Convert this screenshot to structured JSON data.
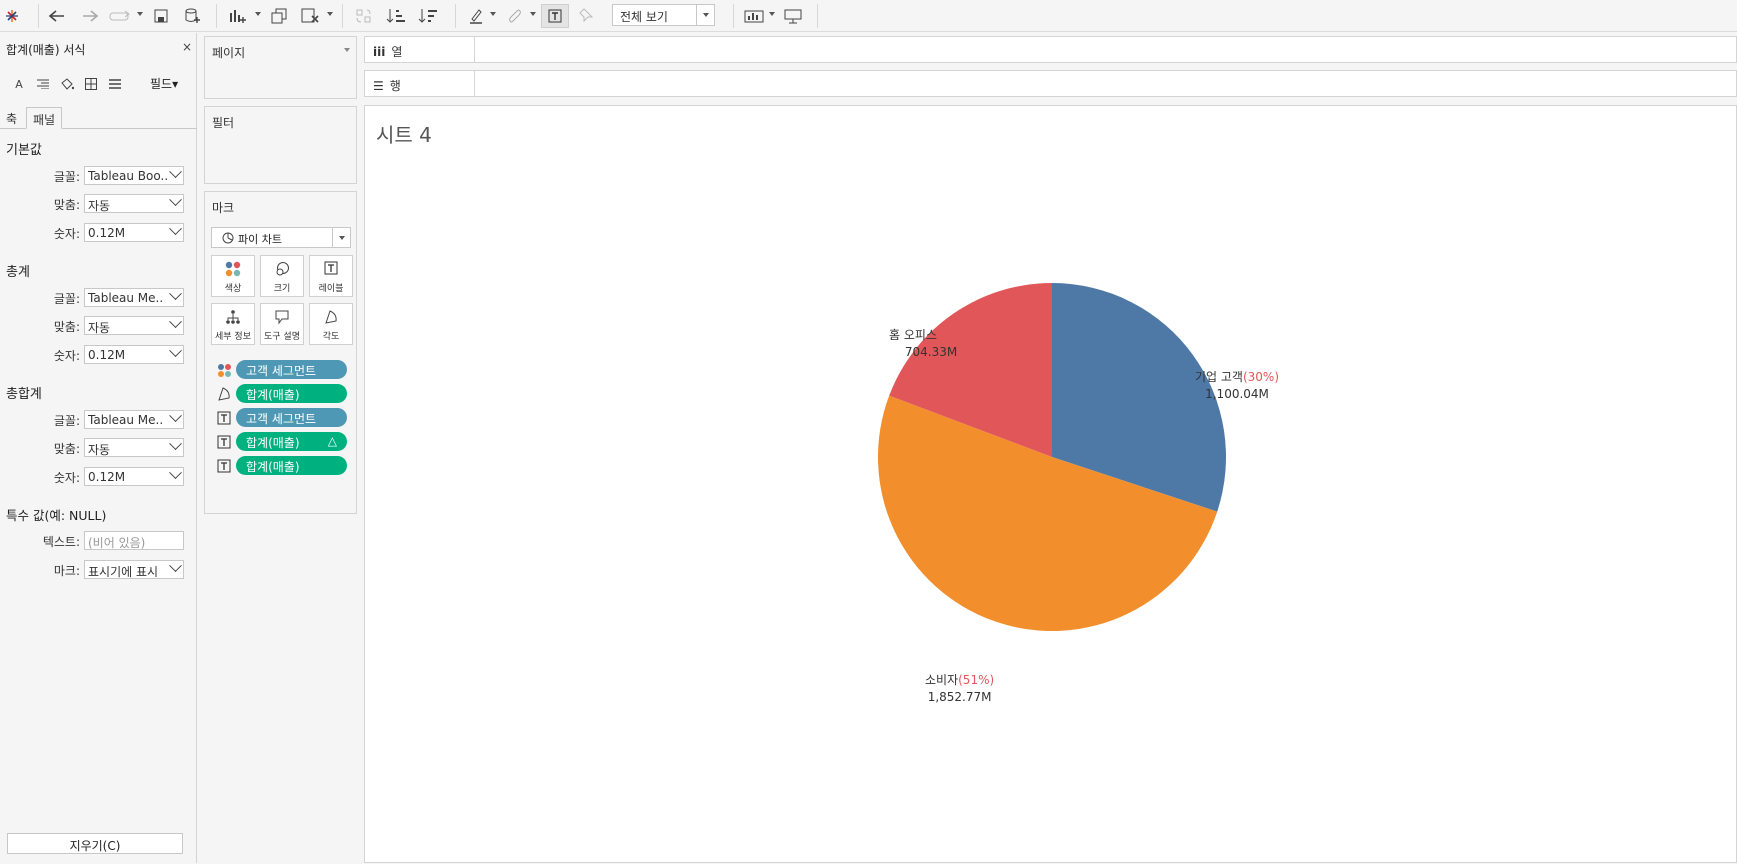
{
  "toolbar": {
    "view_select": "전체 보기"
  },
  "format_pane": {
    "title": "합계(매출) 서식",
    "close": "×",
    "field_dropdown": "필드▾",
    "tabs": [
      "축",
      "패널"
    ],
    "sections": [
      {
        "heading": "기본값",
        "rows": [
          {
            "label": "글꼴:",
            "value": "Tableau Boo.."
          },
          {
            "label": "맞춤:",
            "value": "자동"
          },
          {
            "label": "숫자:",
            "value": "0.12M"
          }
        ]
      },
      {
        "heading": "총계",
        "rows": [
          {
            "label": "글꼴:",
            "value": "Tableau Me.."
          },
          {
            "label": "맞춤:",
            "value": "자동"
          },
          {
            "label": "숫자:",
            "value": "0.12M"
          }
        ]
      },
      {
        "heading": "총합계",
        "rows": [
          {
            "label": "글꼴:",
            "value": "Tableau Me.."
          },
          {
            "label": "맞춤:",
            "value": "자동"
          },
          {
            "label": "숫자:",
            "value": "0.12M"
          }
        ]
      }
    ],
    "special": {
      "heading": "특수 값(예: NULL)",
      "text_label": "텍스트:",
      "text_placeholder": "(비어 있음)",
      "mark_label": "마크:",
      "mark_value": "표시기에 표시"
    },
    "clear_button": "지우기(C)"
  },
  "cards": {
    "pages": "페이지",
    "filters": "필터",
    "marks": "마크",
    "mark_type": "파이 차트",
    "mark_buttons": [
      "색상",
      "크기",
      "레이블",
      "세부 정보",
      "도구 설명",
      "각도"
    ],
    "pills": [
      {
        "label": "고객 세그먼트",
        "kind": "dim",
        "icon": "color-icon"
      },
      {
        "label": "합계(매출)",
        "kind": "meas",
        "icon": "angle-icon"
      },
      {
        "label": "고객 세그먼트",
        "kind": "dim",
        "icon": "label-icon"
      },
      {
        "label": "합계(매출)",
        "kind": "meas",
        "icon": "label-icon",
        "delta": "△"
      },
      {
        "label": "합계(매출)",
        "kind": "meas",
        "icon": "label-icon"
      }
    ]
  },
  "shelves": {
    "columns": "열",
    "rows": "행"
  },
  "sheet": {
    "title": "시트 4"
  },
  "chart_data": {
    "type": "pie",
    "slices": [
      {
        "name": "기업 고객",
        "value": 1100.04,
        "label_value": "1,100.04M",
        "pct": "(30%)",
        "color": "#4e79a7"
      },
      {
        "name": "소비자",
        "value": 1852.77,
        "label_value": "1,852.77M",
        "pct": "(51%)",
        "color": "#f28e2b"
      },
      {
        "name": "홈 오피스",
        "value": 704.33,
        "label_value": "704.33M",
        "pct": "(19%)",
        "color": "#e15759"
      }
    ],
    "start_angle_deg": 0,
    "direction": "clockwise"
  }
}
